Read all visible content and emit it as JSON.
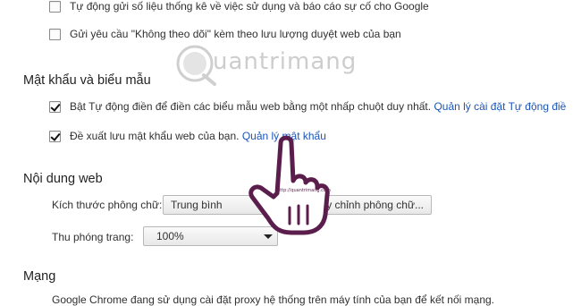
{
  "privacy": {
    "usage_stats_label": "Tự động gửi số liệu thống kê về việc sử dụng và báo cáo sự cố cho Google",
    "dnt_label": "Gửi yêu cầu \"Không theo dõi\" kèm theo lưu lượng duyệt web của bạn"
  },
  "passwords": {
    "title": "Mật khẩu và biểu mẫu",
    "autofill_label": "Bật Tự động điền để điền các biểu mẫu web bằng một nhấp chuột duy nhất.",
    "autofill_link": "Quản lý cài đặt Tự động điề",
    "save_pw_label": "Đề xuất lưu mật khẩu web của bạn.",
    "save_pw_link": "Quản lý mật khẩu"
  },
  "web_content": {
    "title": "Nội dung web",
    "font_size_label": "Kích thước phông chữ:",
    "font_size_value": "Trung bình",
    "customize_fonts_button": "Tùy chỉnh phông chữ...",
    "zoom_label": "Thu phóng trang:",
    "zoom_value": "100%"
  },
  "network": {
    "title": "Mạng",
    "proxy_text": "Google Chrome đang sử dụng cài đặt proxy hệ thống trên máy tính của bạn để kết nối mạng."
  },
  "watermark": {
    "brand": "uantrimang",
    "cursor_caption": "http://quantrimang.com"
  },
  "colors": {
    "link": "#1a55b8",
    "hand_outline": "#5b1e4c",
    "watermark": "#c9c9c9"
  }
}
